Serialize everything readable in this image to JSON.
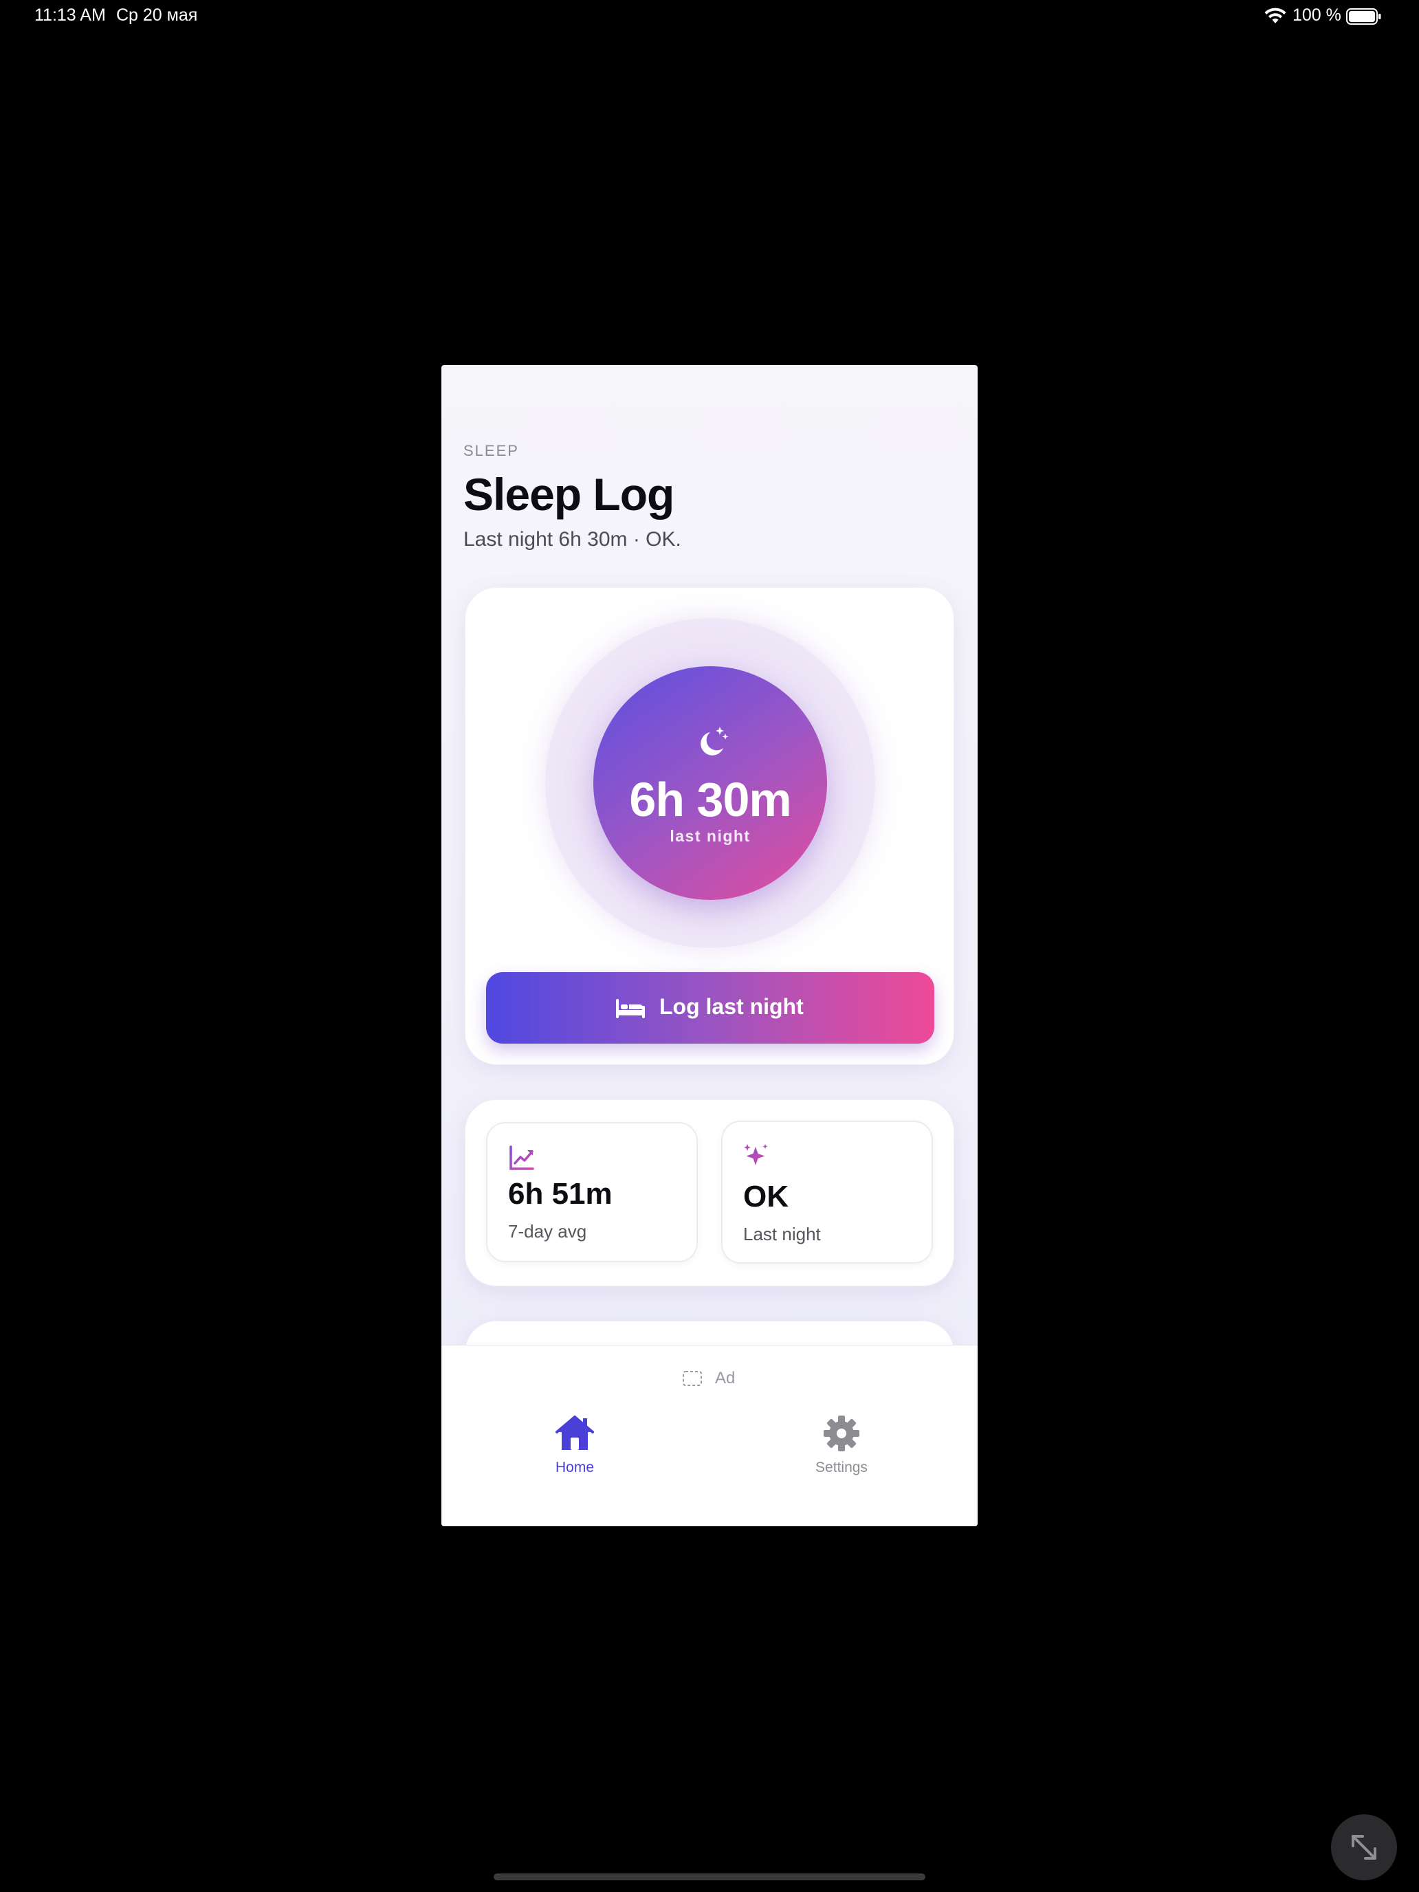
{
  "status_bar": {
    "time": "11:13 AM",
    "date": "Ср 20 мая",
    "battery_percent": "100 %",
    "icons": [
      "wifi-icon",
      "battery-icon"
    ]
  },
  "header": {
    "eyebrow": "SLEEP",
    "title": "Sleep Log",
    "subtitle": "Last night 6h 30m · OK."
  },
  "hero": {
    "icon": "moon-stars-icon",
    "value": "6h 30m",
    "label": "last night",
    "button": {
      "icon": "bed-icon",
      "label": "Log last night"
    }
  },
  "stats": [
    {
      "icon": "trend-chart-icon",
      "value": "6h 51m",
      "caption": "7-day avg"
    },
    {
      "icon": "sparkles-icon",
      "value": "OK",
      "caption": "Last night"
    }
  ],
  "ad": {
    "icon": "ad-placeholder-icon",
    "label": "Ad"
  },
  "tab_bar": {
    "tabs": [
      {
        "icon": "home-icon",
        "label": "Home",
        "active": true
      },
      {
        "icon": "gear-icon",
        "label": "Settings",
        "active": false
      }
    ]
  },
  "colors": {
    "accent": "#4a40d8",
    "gradient_start": "#5048e0",
    "gradient_end": "#ee4a97",
    "inactive": "#8c8c92"
  }
}
